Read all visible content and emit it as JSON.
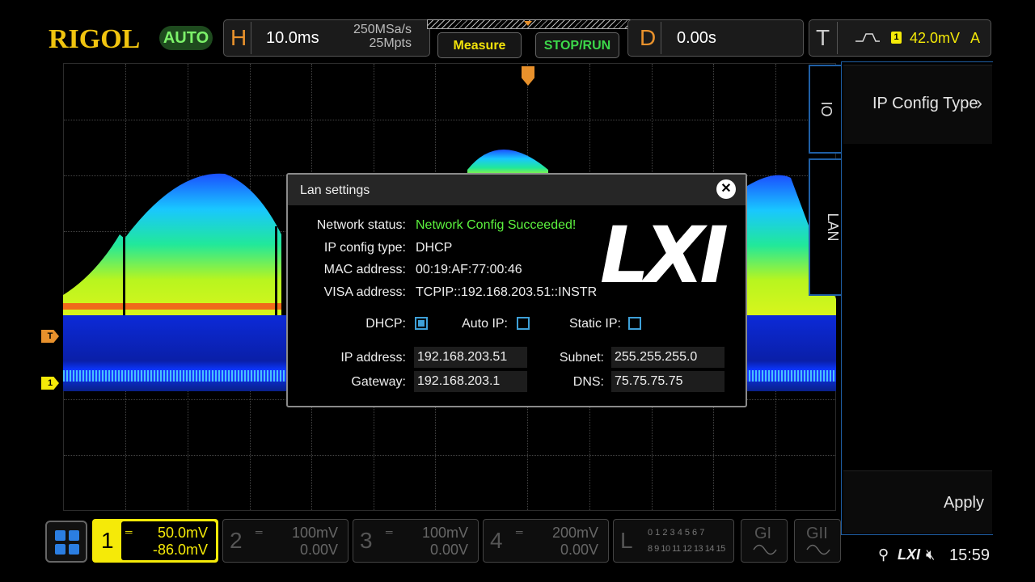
{
  "header": {
    "brand": "RIGOL",
    "auto_label": "AUTO",
    "horizontal": {
      "tag": "H",
      "timebase": "10.0ms",
      "sample_rate": "250MSa/s",
      "memory_depth": "25Mpts"
    },
    "measure_label": "Measure",
    "stop_run_label": "STOP/RUN",
    "delay": {
      "tag": "D",
      "value": "0.00s"
    },
    "trigger": {
      "tag": "T",
      "source": "1",
      "level": "42.0mV",
      "mode": "A"
    }
  },
  "markers": {
    "trigger": "T",
    "channel1": "1"
  },
  "right_panel": {
    "tabs": [
      "IO",
      "LAN"
    ],
    "menu_top": "IP Config Type",
    "menu_bottom": "Apply"
  },
  "lan_dialog": {
    "title": "Lan settings",
    "network_status_label": "Network status:",
    "network_status_value": "Network Config Succeeded!",
    "ip_config_type_label": "IP config type:",
    "ip_config_type_value": "DHCP",
    "mac_label": "MAC address:",
    "mac_value": "00:19:AF:77:00:46",
    "visa_label": "VISA address:",
    "visa_value": "TCPIP::192.168.203.51::INSTR",
    "logo_text": "LXI",
    "dhcp_label": "DHCP:",
    "auto_ip_label": "Auto IP:",
    "static_ip_label": "Static IP:",
    "dhcp_checked": true,
    "auto_ip_checked": false,
    "static_ip_checked": false,
    "ip_label": "IP address:",
    "ip_value": "192.168.203.51",
    "gateway_label": "Gateway:",
    "gateway_value": "192.168.203.1",
    "subnet_label": "Subnet:",
    "subnet_value": "255.255.255.0",
    "dns_label": "DNS:",
    "dns_value": "75.75.75.75"
  },
  "channels": [
    {
      "num": "1",
      "scale": "50.0mV",
      "offset": "-86.0mV",
      "active": true
    },
    {
      "num": "2",
      "scale": "100mV",
      "offset": "0.00V",
      "active": false
    },
    {
      "num": "3",
      "scale": "100mV",
      "offset": "0.00V",
      "active": false
    },
    {
      "num": "4",
      "scale": "200mV",
      "offset": "0.00V",
      "active": false
    }
  ],
  "logic": {
    "label": "L",
    "row1": "0 1 2 3  4 5 6 7",
    "row2": "8 9 10 11 12 13 14 15"
  },
  "generators": [
    "GI",
    "GII"
  ],
  "status": {
    "lxi": "LXI",
    "time": "15:59"
  },
  "colors": {
    "accent": "#e8912c",
    "brand": "#f1c40f",
    "ch1": "#f5ea08",
    "ok": "#5cf23e",
    "panel_border": "#1f5fa5"
  }
}
